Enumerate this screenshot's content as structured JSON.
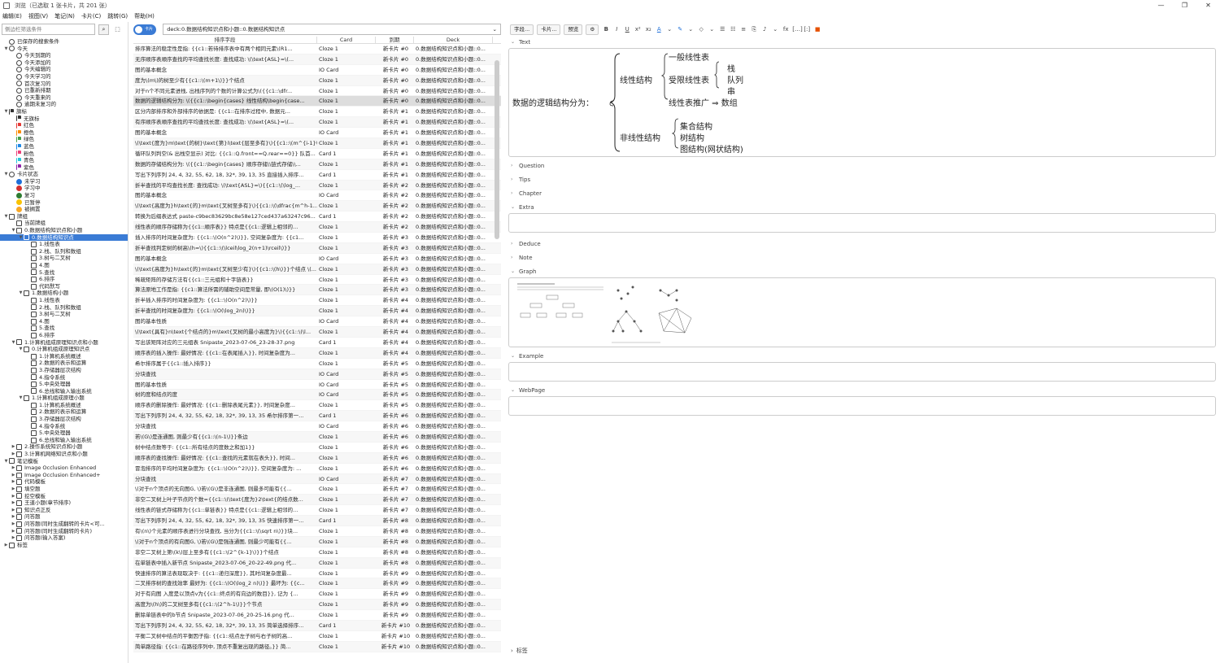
{
  "window": {
    "title": "浏览（已选取 1 张卡片，共 201 张）",
    "min": "—",
    "max": "❐",
    "close": "✕"
  },
  "menu": [
    "编辑(E)",
    "视图(V)",
    "笔记(N)",
    "卡片(C)",
    "跳转(G)",
    "帮助(H)"
  ],
  "sidebar": {
    "filter_placeholder": "侧边栏筛选条件",
    "items": [
      {
        "label": "已保存的搜索条件",
        "lvl": 0,
        "tri": "",
        "icon": "heart-icon",
        "ic": "circ"
      },
      {
        "label": "今天",
        "lvl": 0,
        "tri": "▼",
        "icon": "clock-icon",
        "ic": "circ"
      },
      {
        "label": "今天到期的",
        "lvl": 1,
        "tri": "",
        "icon": "clock-icon",
        "ic": "circ"
      },
      {
        "label": "今天添加的",
        "lvl": 1,
        "tri": "",
        "icon": "clock-icon",
        "ic": "circ"
      },
      {
        "label": "今天编辑的",
        "lvl": 1,
        "tri": "",
        "icon": "clock-icon",
        "ic": "circ"
      },
      {
        "label": "今天学习的",
        "lvl": 1,
        "tri": "",
        "icon": "clock-icon",
        "ic": "circ"
      },
      {
        "label": "首次复习的",
        "lvl": 1,
        "tri": "",
        "icon": "clock-icon",
        "ic": "circ"
      },
      {
        "label": "已重新排期",
        "lvl": 1,
        "tri": "",
        "icon": "clock-icon",
        "ic": "circ"
      },
      {
        "label": "今天重来的",
        "lvl": 1,
        "tri": "",
        "icon": "clock-icon",
        "ic": "circ"
      },
      {
        "label": "逾期未复习的",
        "lvl": 1,
        "tri": "",
        "icon": "clock-icon",
        "ic": "circ"
      },
      {
        "label": "旗标",
        "lvl": 0,
        "tri": "▼",
        "icon": "flag-icon",
        "ic": "flag",
        "color": "#333"
      },
      {
        "label": "无旗标",
        "lvl": 1,
        "tri": "",
        "icon": "flag-off-icon",
        "ic": "flag",
        "color": "#333"
      },
      {
        "label": "红色",
        "lvl": 1,
        "tri": "",
        "icon": "flag-icon",
        "ic": "flag",
        "color": "#e53935"
      },
      {
        "label": "橙色",
        "lvl": 1,
        "tri": "",
        "icon": "flag-icon",
        "ic": "flag",
        "color": "#fb8c00"
      },
      {
        "label": "绿色",
        "lvl": 1,
        "tri": "",
        "icon": "flag-icon",
        "ic": "flag",
        "color": "#43a047"
      },
      {
        "label": "蓝色",
        "lvl": 1,
        "tri": "",
        "icon": "flag-icon",
        "ic": "flag",
        "color": "#1e88e5"
      },
      {
        "label": "粉色",
        "lvl": 1,
        "tri": "",
        "icon": "flag-icon",
        "ic": "flag",
        "color": "#ec407a"
      },
      {
        "label": "青色",
        "lvl": 1,
        "tri": "",
        "icon": "flag-icon",
        "ic": "flag",
        "color": "#26c6da"
      },
      {
        "label": "紫色",
        "lvl": 1,
        "tri": "",
        "icon": "flag-icon",
        "ic": "flag",
        "color": "#8e24aa"
      },
      {
        "label": "卡片状态",
        "lvl": 0,
        "tri": "▼",
        "icon": "circle-icon",
        "ic": "circ"
      },
      {
        "label": "未学习",
        "lvl": 1,
        "tri": "",
        "icon": "dot-icon",
        "ic": "dot",
        "color": "#1e6fd9"
      },
      {
        "label": "学习中",
        "lvl": 1,
        "tri": "",
        "icon": "dot-icon",
        "ic": "dot",
        "color": "#d32f2f"
      },
      {
        "label": "复习",
        "lvl": 1,
        "tri": "",
        "icon": "dot-icon",
        "ic": "dot",
        "color": "#2e7d32"
      },
      {
        "label": "已暂停",
        "lvl": 1,
        "tri": "",
        "icon": "dot-icon",
        "ic": "dot",
        "color": "#f9c300"
      },
      {
        "label": "被搁置",
        "lvl": 1,
        "tri": "",
        "icon": "dot-icon",
        "ic": "dot",
        "color": "#f9a825"
      },
      {
        "label": "牌组",
        "lvl": 0,
        "tri": "▼",
        "icon": "deck-icon",
        "ic": ""
      },
      {
        "label": "当前牌组",
        "lvl": 1,
        "tri": "",
        "icon": "deck-icon",
        "ic": ""
      },
      {
        "label": "0.数据结构知识点和小题",
        "lvl": 1,
        "tri": "▼",
        "icon": "deck-icon",
        "ic": ""
      },
      {
        "label": "0.数据结构知识点",
        "lvl": 2,
        "tri": "▼",
        "icon": "deck-icon",
        "ic": "",
        "sel": true
      },
      {
        "label": "1.线性表",
        "lvl": 3,
        "tri": "",
        "icon": "deck-icon",
        "ic": ""
      },
      {
        "label": "2.栈、队列和数组",
        "lvl": 3,
        "tri": "",
        "icon": "deck-icon",
        "ic": ""
      },
      {
        "label": "3.树与二叉树",
        "lvl": 3,
        "tri": "",
        "icon": "deck-icon",
        "ic": ""
      },
      {
        "label": "4.图",
        "lvl": 3,
        "tri": "",
        "icon": "deck-icon",
        "ic": ""
      },
      {
        "label": "5.查找",
        "lvl": 3,
        "tri": "",
        "icon": "deck-icon",
        "ic": ""
      },
      {
        "label": "6.排序",
        "lvl": 3,
        "tri": "",
        "icon": "deck-icon",
        "ic": ""
      },
      {
        "label": "代码默写",
        "lvl": 3,
        "tri": "",
        "icon": "deck-icon",
        "ic": ""
      },
      {
        "label": "1.数据结构小题",
        "lvl": 2,
        "tri": "▼",
        "icon": "deck-icon",
        "ic": ""
      },
      {
        "label": "1.线性表",
        "lvl": 3,
        "tri": "",
        "icon": "deck-icon",
        "ic": ""
      },
      {
        "label": "2.栈、队列和数组",
        "lvl": 3,
        "tri": "",
        "icon": "deck-icon",
        "ic": ""
      },
      {
        "label": "3.树与二叉树",
        "lvl": 3,
        "tri": "",
        "icon": "deck-icon",
        "ic": ""
      },
      {
        "label": "4.图",
        "lvl": 3,
        "tri": "",
        "icon": "deck-icon",
        "ic": ""
      },
      {
        "label": "5.查找",
        "lvl": 3,
        "tri": "",
        "icon": "deck-icon",
        "ic": ""
      },
      {
        "label": "6.排序",
        "lvl": 3,
        "tri": "",
        "icon": "deck-icon",
        "ic": ""
      },
      {
        "label": "1.计算机组成原理知识点和小题",
        "lvl": 1,
        "tri": "▼",
        "icon": "deck-icon",
        "ic": ""
      },
      {
        "label": "0.计算机组成原理知识点",
        "lvl": 2,
        "tri": "▼",
        "icon": "deck-icon",
        "ic": ""
      },
      {
        "label": "1.计算机系统概述",
        "lvl": 3,
        "tri": "",
        "icon": "deck-icon",
        "ic": ""
      },
      {
        "label": "2.数据的表示和运算",
        "lvl": 3,
        "tri": "",
        "icon": "deck-icon",
        "ic": ""
      },
      {
        "label": "3.存储器层次结构",
        "lvl": 3,
        "tri": "",
        "icon": "deck-icon",
        "ic": ""
      },
      {
        "label": "4.指令系统",
        "lvl": 3,
        "tri": "",
        "icon": "deck-icon",
        "ic": ""
      },
      {
        "label": "5.中央处理器",
        "lvl": 3,
        "tri": "",
        "icon": "deck-icon",
        "ic": ""
      },
      {
        "label": "6.总线和输入输出系统",
        "lvl": 3,
        "tri": "",
        "icon": "deck-icon",
        "ic": ""
      },
      {
        "label": "1.计算机组成原理小题",
        "lvl": 2,
        "tri": "▼",
        "icon": "deck-icon",
        "ic": ""
      },
      {
        "label": "1.计算机系统概述",
        "lvl": 3,
        "tri": "",
        "icon": "deck-icon",
        "ic": ""
      },
      {
        "label": "2.数据的表示和运算",
        "lvl": 3,
        "tri": "",
        "icon": "deck-icon",
        "ic": ""
      },
      {
        "label": "3.存储器层次结构",
        "lvl": 3,
        "tri": "",
        "icon": "deck-icon",
        "ic": ""
      },
      {
        "label": "4.指令系统",
        "lvl": 3,
        "tri": "",
        "icon": "deck-icon",
        "ic": ""
      },
      {
        "label": "5.中央处理器",
        "lvl": 3,
        "tri": "",
        "icon": "deck-icon",
        "ic": ""
      },
      {
        "label": "6.总线和输入输出系统",
        "lvl": 3,
        "tri": "",
        "icon": "deck-icon",
        "ic": ""
      },
      {
        "label": "2.操作系统知识点和小题",
        "lvl": 1,
        "tri": "▶",
        "icon": "deck-icon",
        "ic": ""
      },
      {
        "label": "3.计算机网络知识点和小题",
        "lvl": 1,
        "tri": "▶",
        "icon": "deck-icon",
        "ic": ""
      },
      {
        "label": "笔记模板",
        "lvl": 0,
        "tri": "▼",
        "icon": "notetype-icon",
        "ic": ""
      },
      {
        "label": "Image Occlusion Enhanced",
        "lvl": 1,
        "tri": "▶",
        "icon": "notetype-icon",
        "ic": ""
      },
      {
        "label": "Image Occlusion Enhanced+",
        "lvl": 1,
        "tri": "▶",
        "icon": "notetype-icon",
        "ic": ""
      },
      {
        "label": "代码模板",
        "lvl": 1,
        "tri": "▶",
        "icon": "notetype-icon",
        "ic": ""
      },
      {
        "label": "填空题",
        "lvl": 1,
        "tri": "▶",
        "icon": "notetype-icon",
        "ic": ""
      },
      {
        "label": "挖空模板",
        "lvl": 1,
        "tri": "▶",
        "icon": "notetype-icon",
        "ic": ""
      },
      {
        "label": "王道小题(章节排序)",
        "lvl": 1,
        "tri": "▶",
        "icon": "notetype-icon",
        "ic": ""
      },
      {
        "label": "知识点正反",
        "lvl": 1,
        "tri": "▶",
        "icon": "notetype-icon",
        "ic": ""
      },
      {
        "label": "问答题",
        "lvl": 1,
        "tri": "▶",
        "icon": "notetype-icon",
        "ic": ""
      },
      {
        "label": "问答题(同时生成翻转的卡片<可...",
        "lvl": 1,
        "tri": "▶",
        "icon": "notetype-icon",
        "ic": ""
      },
      {
        "label": "问答题(同时生成翻转的卡片)",
        "lvl": 1,
        "tri": "▶",
        "icon": "notetype-icon",
        "ic": ""
      },
      {
        "label": "问答题(输入答案)",
        "lvl": 1,
        "tri": "▶",
        "icon": "notetype-icon",
        "ic": ""
      },
      {
        "label": "标签",
        "lvl": 0,
        "tri": "▶",
        "icon": "tag-icon",
        "ic": ""
      }
    ]
  },
  "search": {
    "toggle_label": "卡片",
    "query": "deck:0.数据结构知识点和小题::0.数据结构知识点"
  },
  "table": {
    "headers": [
      "排序字段",
      "Card",
      "到期",
      "Deck"
    ],
    "selected_index": 5,
    "rows": [
      [
        "排序算法的稳定性是指: {{c1::若待排序表中有两个相同元素\\(R1...",
        "Cloze 1",
        "新卡片 #0",
        "0.数据结构知识点和小题::0..."
      ],
      [
        "无序顺序表顺序查找的平均查找长度: 查找成功: \\(\\text{ASL}=\\(...",
        "Cloze 1",
        "新卡片 #0",
        "0.数据结构知识点和小题::0..."
      ],
      [
        "图的基本概念",
        "IO Card",
        "新卡片 #0",
        "0.数据结构知识点和小题::0..."
      ],
      [
        "度为\\(m\\)的树至少有{{c1::\\(m+1\\)}}个结点",
        "Cloze 1",
        "新卡片 #0",
        "0.数据结构知识点和小题::0..."
      ],
      [
        "对于n个不同元素进栈, 出栈序列的个数的计算公式为\\({{c1::\\dfr...",
        "Cloze 1",
        "新卡片 #0",
        "0.数据结构知识点和小题::0..."
      ],
      [
        "数据的逻辑结构分为: \\({{c1::\\begin{cases} 线性结构\\begin{case...",
        "Cloze 1",
        "新卡片 #0",
        "0.数据结构知识点和小题::0..."
      ],
      [
        "区分内部排序和外部排序的依据是: {{c1::在排序过程中, 数据元...",
        "Cloze 1",
        "新卡片 #1",
        "0.数据结构知识点和小题::0..."
      ],
      [
        "有序顺序表顺序查找的平均查找长度: 查找成功: \\(\\text{ASL}=\\(...",
        "Cloze 1",
        "新卡片 #1",
        "0.数据结构知识点和小题::0..."
      ],
      [
        "图的基本概念",
        "IO Card",
        "新卡片 #1",
        "0.数据结构知识点和小题::0..."
      ],
      [
        "\\(\\text{度为}m\\text{的树}\\text{第}i\\text{层至多有}\\){{c1::\\(m^{i-1}\\)}}个...",
        "Cloze 1",
        "新卡片 #1",
        "0.数据结构知识点和小题::0..."
      ],
      [
        "循环队列判空(& 出栈空显示) 对比: {{c1::Q.front==Q.rear==0}} 队首...",
        "Card 1",
        "新卡片 #1",
        "0.数据结构知识点和小题::0..."
      ],
      [
        "数据的存储结构分为: \\({{c1::\\begin{cases} 顺序存储\\\\链式存储\\\\...",
        "Cloze 1",
        "新卡片 #1",
        "0.数据结构知识点和小题::0..."
      ],
      [
        "写出下列序列 24, 4, 32, 55, 62, 18, 32*, 39, 13, 35 直接插入排序...",
        "Card 1",
        "新卡片 #1",
        "0.数据结构知识点和小题::0..."
      ],
      [
        "折半查找的平均查找长度: 查找成功: \\(\\text{ASL}=\\){{c1::\\(\\log_...",
        "Cloze 1",
        "新卡片 #2",
        "0.数据结构知识点和小题::0..."
      ],
      [
        "图的基本概念",
        "IO Card",
        "新卡片 #2",
        "0.数据结构知识点和小题::0..."
      ],
      [
        "\\(\\text{高度为}h\\text{的}m\\text{叉树至多有}\\){{c1::\\(\\dfrac{m^h-1...",
        "Cloze 1",
        "新卡片 #2",
        "0.数据结构知识点和小题::0..."
      ],
      [
        "转换为后缀表达式 paste-c9bec83629bc8e58e127ced437a63247c96...",
        "Card 1",
        "新卡片 #2",
        "0.数据结构知识点和小题::0..."
      ],
      [
        "线性表的顺序存储称为{{c1::顺序表}} 特点是{{c1::逻辑上相邻的...",
        "Cloze 1",
        "新卡片 #2",
        "0.数据结构知识点和小题::0..."
      ],
      [
        "插入排序的时间复杂度为: {{c1::\\(O(n^2)\\)}}, 空间复杂度为: {{c1...",
        "Cloze 1",
        "新卡片 #3",
        "0.数据结构知识点和小题::0..."
      ],
      [
        "折半查找判定树的树高\\(h=\\){{c1::\\(\\lceil\\log_2(n+1)\\rceil\\)}}",
        "Cloze 1",
        "新卡片 #3",
        "0.数据结构知识点和小题::0..."
      ],
      [
        "图的基本概念",
        "IO Card",
        "新卡片 #3",
        "0.数据结构知识点和小题::0..."
      ],
      [
        "\\(\\text{高度为}h\\text{的}m\\text{叉树至少有}\\){{c1::\\(h\\)}}个结点 \\(...",
        "Cloze 1",
        "新卡片 #3",
        "0.数据结构知识点和小题::0..."
      ],
      [
        "稀疏矩阵的存储方法有{{c1::三元组和十字链表}}",
        "Cloze 1",
        "新卡片 #3",
        "0.数据结构知识点和小题::0..."
      ],
      [
        "算法原地工作是指: {{c1::算法所需的辅助空间是常量, 即\\(O(1)\\)}}",
        "Cloze 1",
        "新卡片 #3",
        "0.数据结构知识点和小题::0..."
      ],
      [
        "折半插入排序的时间复杂度为: {{c1::\\(O(n^2)\\)}}",
        "Cloze 1",
        "新卡片 #4",
        "0.数据结构知识点和小题::0..."
      ],
      [
        "折半查找的时间复杂度为: {{c1::\\(O(\\log_2n)\\)}}",
        "Cloze 1",
        "新卡片 #4",
        "0.数据结构知识点和小题::0..."
      ],
      [
        "图的基本性质",
        "IO Card",
        "新卡片 #4",
        "0.数据结构知识点和小题::0..."
      ],
      [
        "\\(\\text{具有}n\\text{个结点的}m\\text{叉树的最小高度为}\\){{c1::\\(\\l...",
        "Cloze 1",
        "新卡片 #4",
        "0.数据结构知识点和小题::0..."
      ],
      [
        "写出该矩阵对应的三元组表 Snipaste_2023-07-06_23-28-37.png",
        "Card 1",
        "新卡片 #4",
        "0.数据结构知识点和小题::0..."
      ],
      [
        "顺序表的插入操作: 最好情况: {{c1::在表尾插入}}, 时间复杂度为...",
        "Cloze 1",
        "新卡片 #4",
        "0.数据结构知识点和小题::0..."
      ],
      [
        "希尔排序属于{{c1::插入排序}}",
        "Cloze 1",
        "新卡片 #5",
        "0.数据结构知识点和小题::0..."
      ],
      [
        "分块查找",
        "IO Card",
        "新卡片 #5",
        "0.数据结构知识点和小题::0..."
      ],
      [
        "图的基本性质",
        "IO Card",
        "新卡片 #5",
        "0.数据结构知识点和小题::0..."
      ],
      [
        "树的度和结点的度",
        "IO Card",
        "新卡片 #5",
        "0.数据结构知识点和小题::0..."
      ],
      [
        "顺序表的删除操作: 最好情况: {{c1::删除表尾元素}}, 时间复杂度...",
        "Cloze 1",
        "新卡片 #5",
        "0.数据结构知识点和小题::0..."
      ],
      [
        "写出下列序列 24, 4, 32, 55, 62, 18, 32*, 39, 13, 35 希尔排序第一...",
        "Card 1",
        "新卡片 #6",
        "0.数据结构知识点和小题::0..."
      ],
      [
        "分块查找",
        "IO Card",
        "新卡片 #6",
        "0.数据结构知识点和小题::0..."
      ],
      [
        "若\\(G\\)是连通图, 则最少有{{c1::\\(n-1\\)}}条边",
        "Cloze 1",
        "新卡片 #6",
        "0.数据结构知识点和小题::0..."
      ],
      [
        "树中结点数等于: {{c1::所有结点的度数之和加1}}",
        "Cloze 1",
        "新卡片 #6",
        "0.数据结构知识点和小题::0..."
      ],
      [
        "顺序表的查找操作: 最好情况: {{c1::查找的元素就在表头}}, 时间...",
        "Cloze 1",
        "新卡片 #6",
        "0.数据结构知识点和小题::0..."
      ],
      [
        "冒泡排序的平均时间复杂度为: {{c1::\\(O(n^2)\\)}}, 空间复杂度为: ...",
        "Cloze 1",
        "新卡片 #6",
        "0.数据结构知识点和小题::0..."
      ],
      [
        "分块查找",
        "IO Card",
        "新卡片 #7",
        "0.数据结构知识点和小题::0..."
      ],
      [
        "\\(对于n个顶点的无向图G, \\)若\\(G\\)是非连通图, 则最多可能有{{...",
        "Cloze 1",
        "新卡片 #7",
        "0.数据结构知识点和小题::0..."
      ],
      [
        "非空二叉树上叶子节点的个数={{c1::\\(\\text{度为}2\\text{的结点数...",
        "Cloze 1",
        "新卡片 #7",
        "0.数据结构知识点和小题::0..."
      ],
      [
        "线性表的链式存储称为{{c1::单链表}} 特点是{{c1::逻辑上相邻的...",
        "Cloze 1",
        "新卡片 #7",
        "0.数据结构知识点和小题::0..."
      ],
      [
        "写出下列序列 24, 4, 32, 55, 62, 18, 32*, 39, 13, 35 快速排序第一...",
        "Card 1",
        "新卡片 #8",
        "0.数据结构知识点和小题::0..."
      ],
      [
        "有\\(n\\)个元素的顺序表进行分块查找, 当分为{{c1::\\(\\sqrt n\\)}}块...",
        "Cloze 1",
        "新卡片 #8",
        "0.数据结构知识点和小题::0..."
      ],
      [
        "\\(对于n个顶点的有向图G, \\)若\\(G\\)是强连通图, 则最少可能有{{...",
        "Cloze 1",
        "新卡片 #8",
        "0.数据结构知识点和小题::0..."
      ],
      [
        "非空二叉树上第\\(k\\)层上至多有{{c1::\\(2^{k-1}\\)}}个结点",
        "Cloze 1",
        "新卡片 #8",
        "0.数据结构知识点和小题::0..."
      ],
      [
        "在单链表中插入新节点 Snipaste_2023-07-06_20-22-49.png 代...",
        "Cloze 1",
        "新卡片 #8",
        "0.数据结构知识点和小题::0..."
      ],
      [
        "快速排序的算法表现取决于: {{c1::递归深度}}, 其时间复杂度最...",
        "Cloze 1",
        "新卡片 #9",
        "0.数据结构知识点和小题::0..."
      ],
      [
        "二叉排序树的查找效率 最好为: {{c1::\\(O(\\log_2 n)\\)}} 最坏为: {{c...",
        "Cloze 1",
        "新卡片 #9",
        "0.数据结构知识点和小题::0..."
      ],
      [
        "对于有向图 入度是以顶点v为{{c1::终点的有向边的数目}}, 记为 {...",
        "Cloze 1",
        "新卡片 #9",
        "0.数据结构知识点和小题::0..."
      ],
      [
        "高度为\\(h\\)的二叉树至多有{{c1::\\(2^h-1\\)}}个节点",
        "Cloze 1",
        "新卡片 #9",
        "0.数据结构知识点和小题::0..."
      ],
      [
        "删除单链表中的b节点 Snipaste_2023-07-06_20-25-16.png 代...",
        "Cloze 1",
        "新卡片 #9",
        "0.数据结构知识点和小题::0..."
      ],
      [
        "写出下列序列 24, 4, 32, 55, 62, 18, 32*, 39, 13, 35 简单选择排序...",
        "Card 1",
        "新卡片 #10",
        "0.数据结构知识点和小题::0..."
      ],
      [
        "平衡二叉树中结点的平衡因子指: {{c1::结点左子树与右子树的高...",
        "Cloze 1",
        "新卡片 #10",
        "0.数据结构知识点和小题::0..."
      ],
      [
        "简单路径指: {{c1::在路径序列中, 顶点不重复出现的路径。}} 简...",
        "Cloze 1",
        "新卡片 #10",
        "0.数据结构知识点和小题::0..."
      ]
    ]
  },
  "editor": {
    "toolbar": {
      "fields": "字段...",
      "cards": "卡片...",
      "preview": "预览"
    },
    "fields": [
      "Text",
      "Question",
      "Tips",
      "Chapter",
      "Extra",
      "Deduce",
      "Note",
      "Graph",
      "Example",
      "WebPage"
    ],
    "text_content": {
      "lead": "数据的逻辑结构分为：",
      "linear": "线性结构",
      "general_linear": "一般线性表",
      "restricted_linear": "受限线性表",
      "stack": "栈",
      "queue": "队列",
      "string": "串",
      "generalization": "线性表推广 ⇒ 数组",
      "nonlinear": "非线性结构",
      "set": "集合结构",
      "tree": "树结构",
      "graph": "图结构(网状结构)"
    },
    "tags_label": "标签"
  }
}
